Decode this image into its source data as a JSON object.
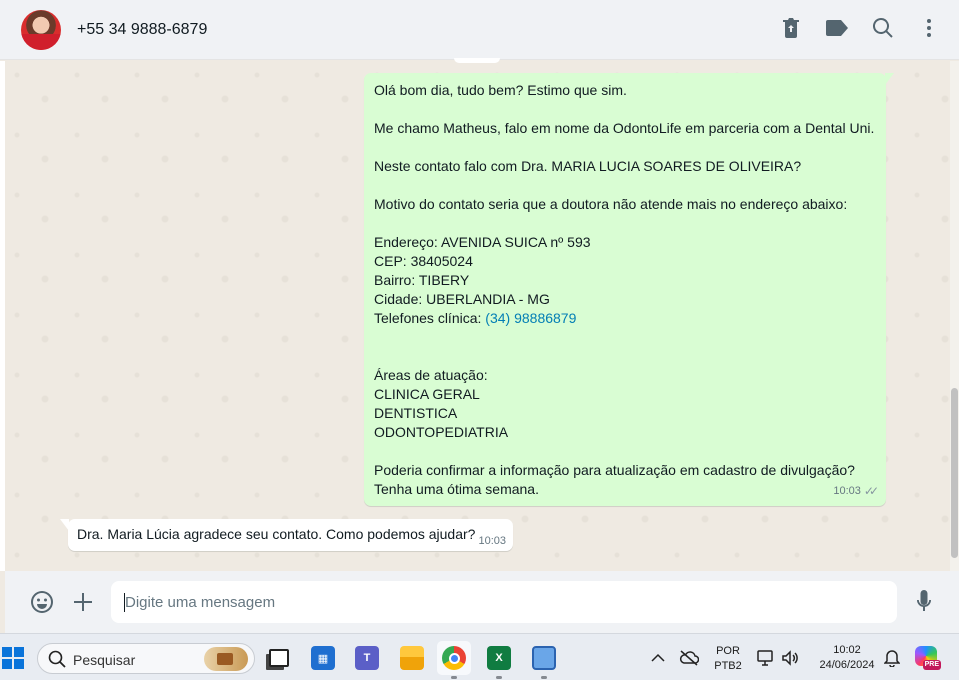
{
  "header": {
    "contact_name": "+55 34 9888-6879",
    "icons": [
      "delete-icon",
      "label-icon",
      "search-icon",
      "menu-icon"
    ]
  },
  "messages": [
    {
      "direction": "outgoing",
      "paragraphs": [
        "Olá bom dia, tudo bem? Estimo que sim.",
        "Me chamo Matheus, falo em nome da OdontoLife em parceria com a Dental Uni.",
        "Neste contato falo com Dra. MARIA LUCIA SOARES DE OLIVEIRA?",
        "Motivo do contato seria que a doutora não atende mais no endereço abaixo:"
      ],
      "address_lines": [
        "Endereço: AVENIDA SUICA nº 593",
        "CEP: 38405024",
        "Bairro: TIBERY",
        "Cidade: UBERLANDIA - MG"
      ],
      "phone_label": "Telefones clínica: ",
      "phone_link": "(34) 98886879",
      "areas_title": "Áreas de atuação:",
      "areas": [
        "CLINICA GERAL",
        "DENTISTICA",
        "ODONTOPEDIATRIA"
      ],
      "closing": [
        "Poderia confirmar a informação para atualização em cadastro de divulgação?",
        "Tenha uma ótima semana."
      ],
      "time": "10:03",
      "status": "delivered"
    },
    {
      "direction": "incoming",
      "text": "Dra. Maria Lúcia agradece seu contato. Como podemos ajudar?",
      "time": "10:03"
    }
  ],
  "compose": {
    "placeholder": "Digite uma mensagem",
    "value": ""
  },
  "taskbar": {
    "search_placeholder": "Pesquisar",
    "apps": [
      "task-view",
      "microsoft-store",
      "teams",
      "file-explorer",
      "chrome",
      "excel",
      "notepad"
    ],
    "active_app": "chrome",
    "language": "POR",
    "keyboard": "PTB2",
    "time": "10:02",
    "date": "24/06/2024",
    "copilot_badge": "PRE"
  }
}
